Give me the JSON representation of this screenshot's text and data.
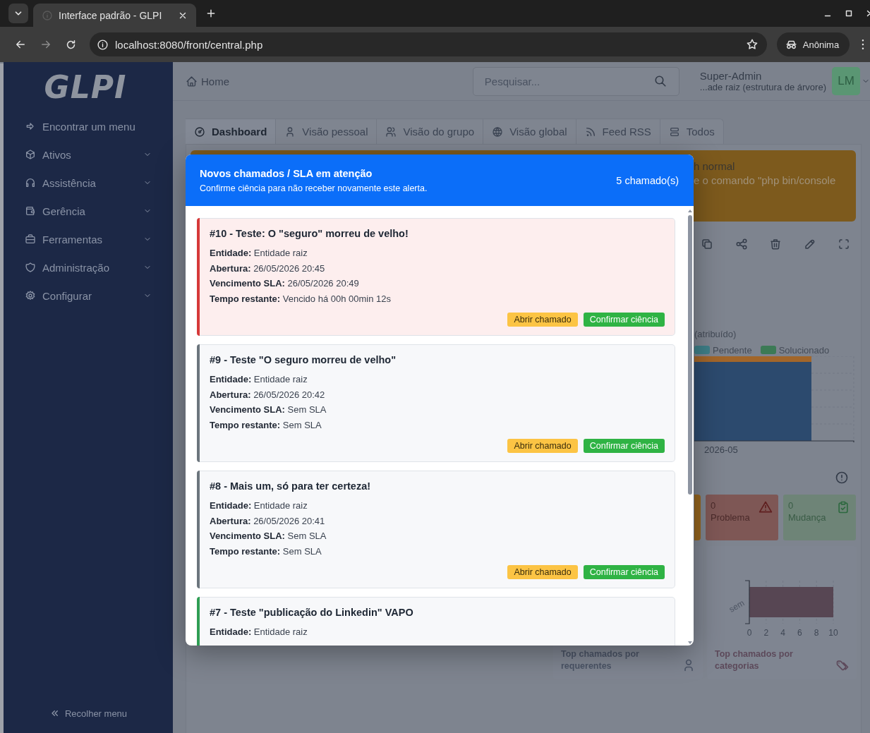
{
  "browser": {
    "tab_title": "Interface padrão - GLPI",
    "url": "localhost:8080/front/central.php",
    "profile": "Anônima"
  },
  "sidebar": {
    "logo": "GLPI",
    "items": [
      {
        "label": "Encontrar um menu",
        "kind": "search"
      },
      {
        "label": "Ativos",
        "kind": "menu"
      },
      {
        "label": "Assistência",
        "kind": "menu"
      },
      {
        "label": "Gerência",
        "kind": "menu"
      },
      {
        "label": "Ferramentas",
        "kind": "menu"
      },
      {
        "label": "Administração",
        "kind": "menu"
      },
      {
        "label": "Configurar",
        "kind": "menu"
      }
    ],
    "collapse": "Recolher menu"
  },
  "header": {
    "breadcrumb": "Home",
    "search_placeholder": "Pesquisar...",
    "user_name": "Super-Admin",
    "user_entity": "...ade raiz (estrutura de árvore)",
    "avatar": "LM"
  },
  "tabs": [
    {
      "label": "Dashboard",
      "selected": true
    },
    {
      "label": "Visão pessoal",
      "selected": false
    },
    {
      "label": "Visão do grupo",
      "selected": false
    },
    {
      "label": "Visão global",
      "selected": false
    },
    {
      "label": "Feed RSS",
      "selected": false
    },
    {
      "label": "Todos",
      "selected": false
    }
  ],
  "dashboard": {
    "alert_lines": [
      "h normal",
      "e o comando \"php bin/console"
    ],
    "status_chart": {
      "title": "(atribuído)",
      "legend": [
        {
          "name": "Pendente",
          "color": "#3e7f88"
        },
        {
          "name": "Solucionado",
          "color": "#3c7a55"
        }
      ],
      "category": "2026-05"
    },
    "counters": [
      {
        "value": "0",
        "label": "Problema",
        "kind": "problem"
      },
      {
        "value": "0",
        "label": "Mudança",
        "kind": "change"
      }
    ],
    "requester_card": {
      "title": "Top chamados por requerentes"
    },
    "category_card": {
      "title": "Top chamados por categorias",
      "chart_data": {
        "type": "bar",
        "orientation": "horizontal",
        "categories": [
          "sem"
        ],
        "values": [
          10
        ],
        "xlim": [
          0,
          10
        ],
        "xticks": [
          0,
          2,
          4,
          6,
          8,
          10
        ],
        "grid": true
      }
    }
  },
  "modal": {
    "title": "Novos chamados / SLA em atenção",
    "subtitle": "Confirme ciência para não receber novamente este alerta.",
    "count": "5 chamado(s)",
    "tickets": [
      {
        "title": "#10 - Teste: O \"seguro\" morreu de velho!",
        "color": "#d63939",
        "expired": true,
        "fields": [
          "**Entidade:** Entidade raiz",
          "**Abertura:** 26/05/2026 20:45",
          "**Vencimento SLA:** 26/05/2026 20:49",
          "**Tempo restante:** Vencido há 00h 00min 12s"
        ],
        "actions": [
          "Abrir chamado",
          "Confirmar ciência"
        ]
      },
      {
        "title": "#9 - Teste \"O seguro morreu de velho\"",
        "color": "#6c757d",
        "expired": false,
        "fields": [
          "**Entidade:** Entidade raiz",
          "**Abertura:** 26/05/2026 20:42",
          "**Vencimento SLA:** Sem SLA",
          "**Tempo restante:** Sem SLA"
        ],
        "actions": [
          "Abrir chamado",
          "Confirmar ciência"
        ]
      },
      {
        "title": "#8 - Mais um, só para ter certeza!",
        "color": "#6c757d",
        "expired": false,
        "fields": [
          "**Entidade:** Entidade raiz",
          "**Abertura:** 26/05/2026 20:41",
          "**Vencimento SLA:** Sem SLA",
          "**Tempo restante:** Sem SLA"
        ],
        "actions": [
          "Abrir chamado",
          "Confirmar ciência"
        ]
      },
      {
        "title": "#7 - Teste \"publicação do Linkedin\" VAPO",
        "color": "#2f9e54",
        "expired": false,
        "fields": [
          "**Entidade:** Entidade raiz"
        ]
      }
    ]
  }
}
